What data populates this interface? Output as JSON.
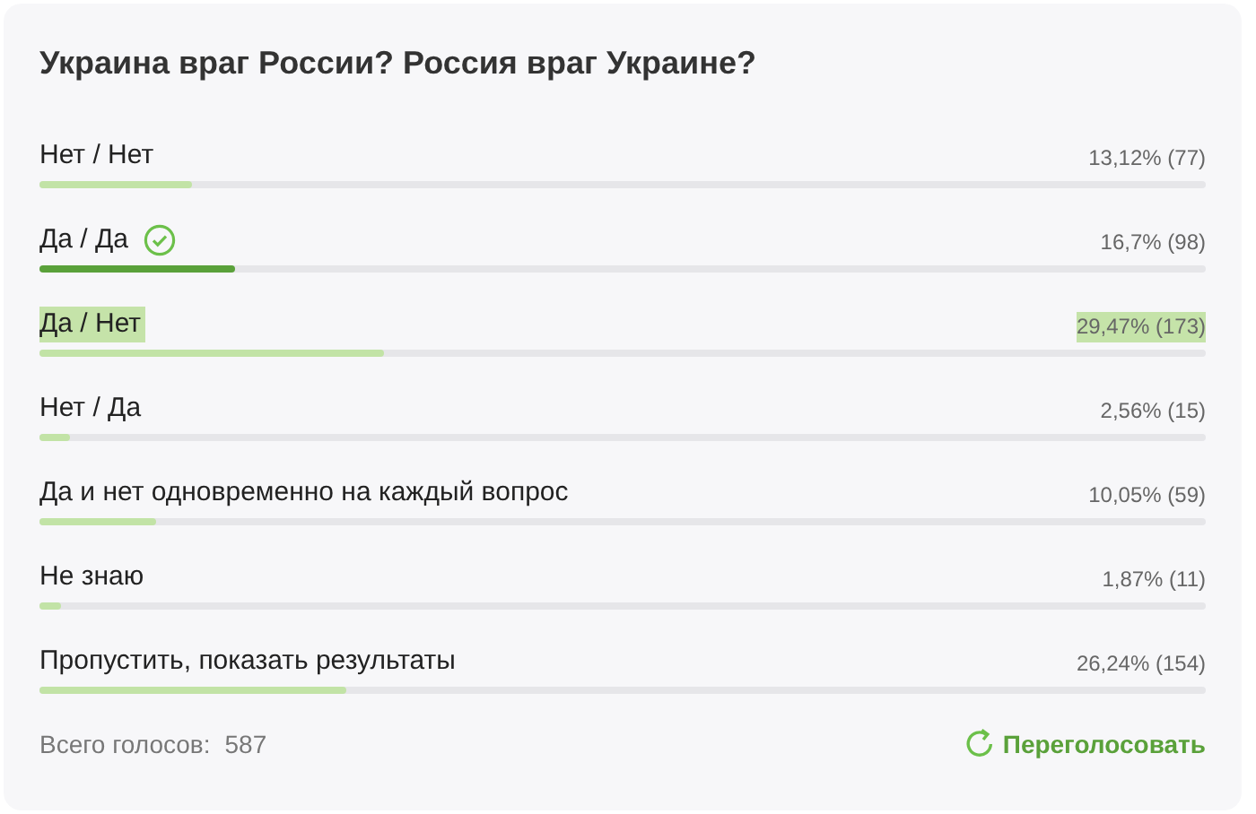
{
  "poll": {
    "question": "Украина враг России? Россия враг Украине?",
    "options": [
      {
        "label": "Нет / Нет",
        "result": "13,12% (77)",
        "level": 0.1312,
        "voted": false,
        "highlighted": false
      },
      {
        "label": "Да / Да",
        "result": "16,7% (98)",
        "level": 0.167,
        "voted": true,
        "highlighted": false
      },
      {
        "label": "Да / Нет",
        "result": "29,47% (173)",
        "level": 0.2947,
        "voted": false,
        "highlighted": true
      },
      {
        "label": "Нет / Да",
        "result": "2,56% (15)",
        "level": 0.0256,
        "voted": false,
        "highlighted": false
      },
      {
        "label": "Да и нет одновременно на каждый вопрос",
        "result": "10,05% (59)",
        "level": 0.1005,
        "voted": false,
        "highlighted": false
      },
      {
        "label": "Не знаю",
        "result": "1,87% (11)",
        "level": 0.0187,
        "voted": false,
        "highlighted": false
      },
      {
        "label": "Пропустить, показать результаты",
        "result": "26,24% (154)",
        "level": 0.2624,
        "voted": false,
        "highlighted": false
      }
    ],
    "total_label": "Всего голосов:",
    "total_value": "587",
    "revote_button": "Переголосовать"
  }
}
